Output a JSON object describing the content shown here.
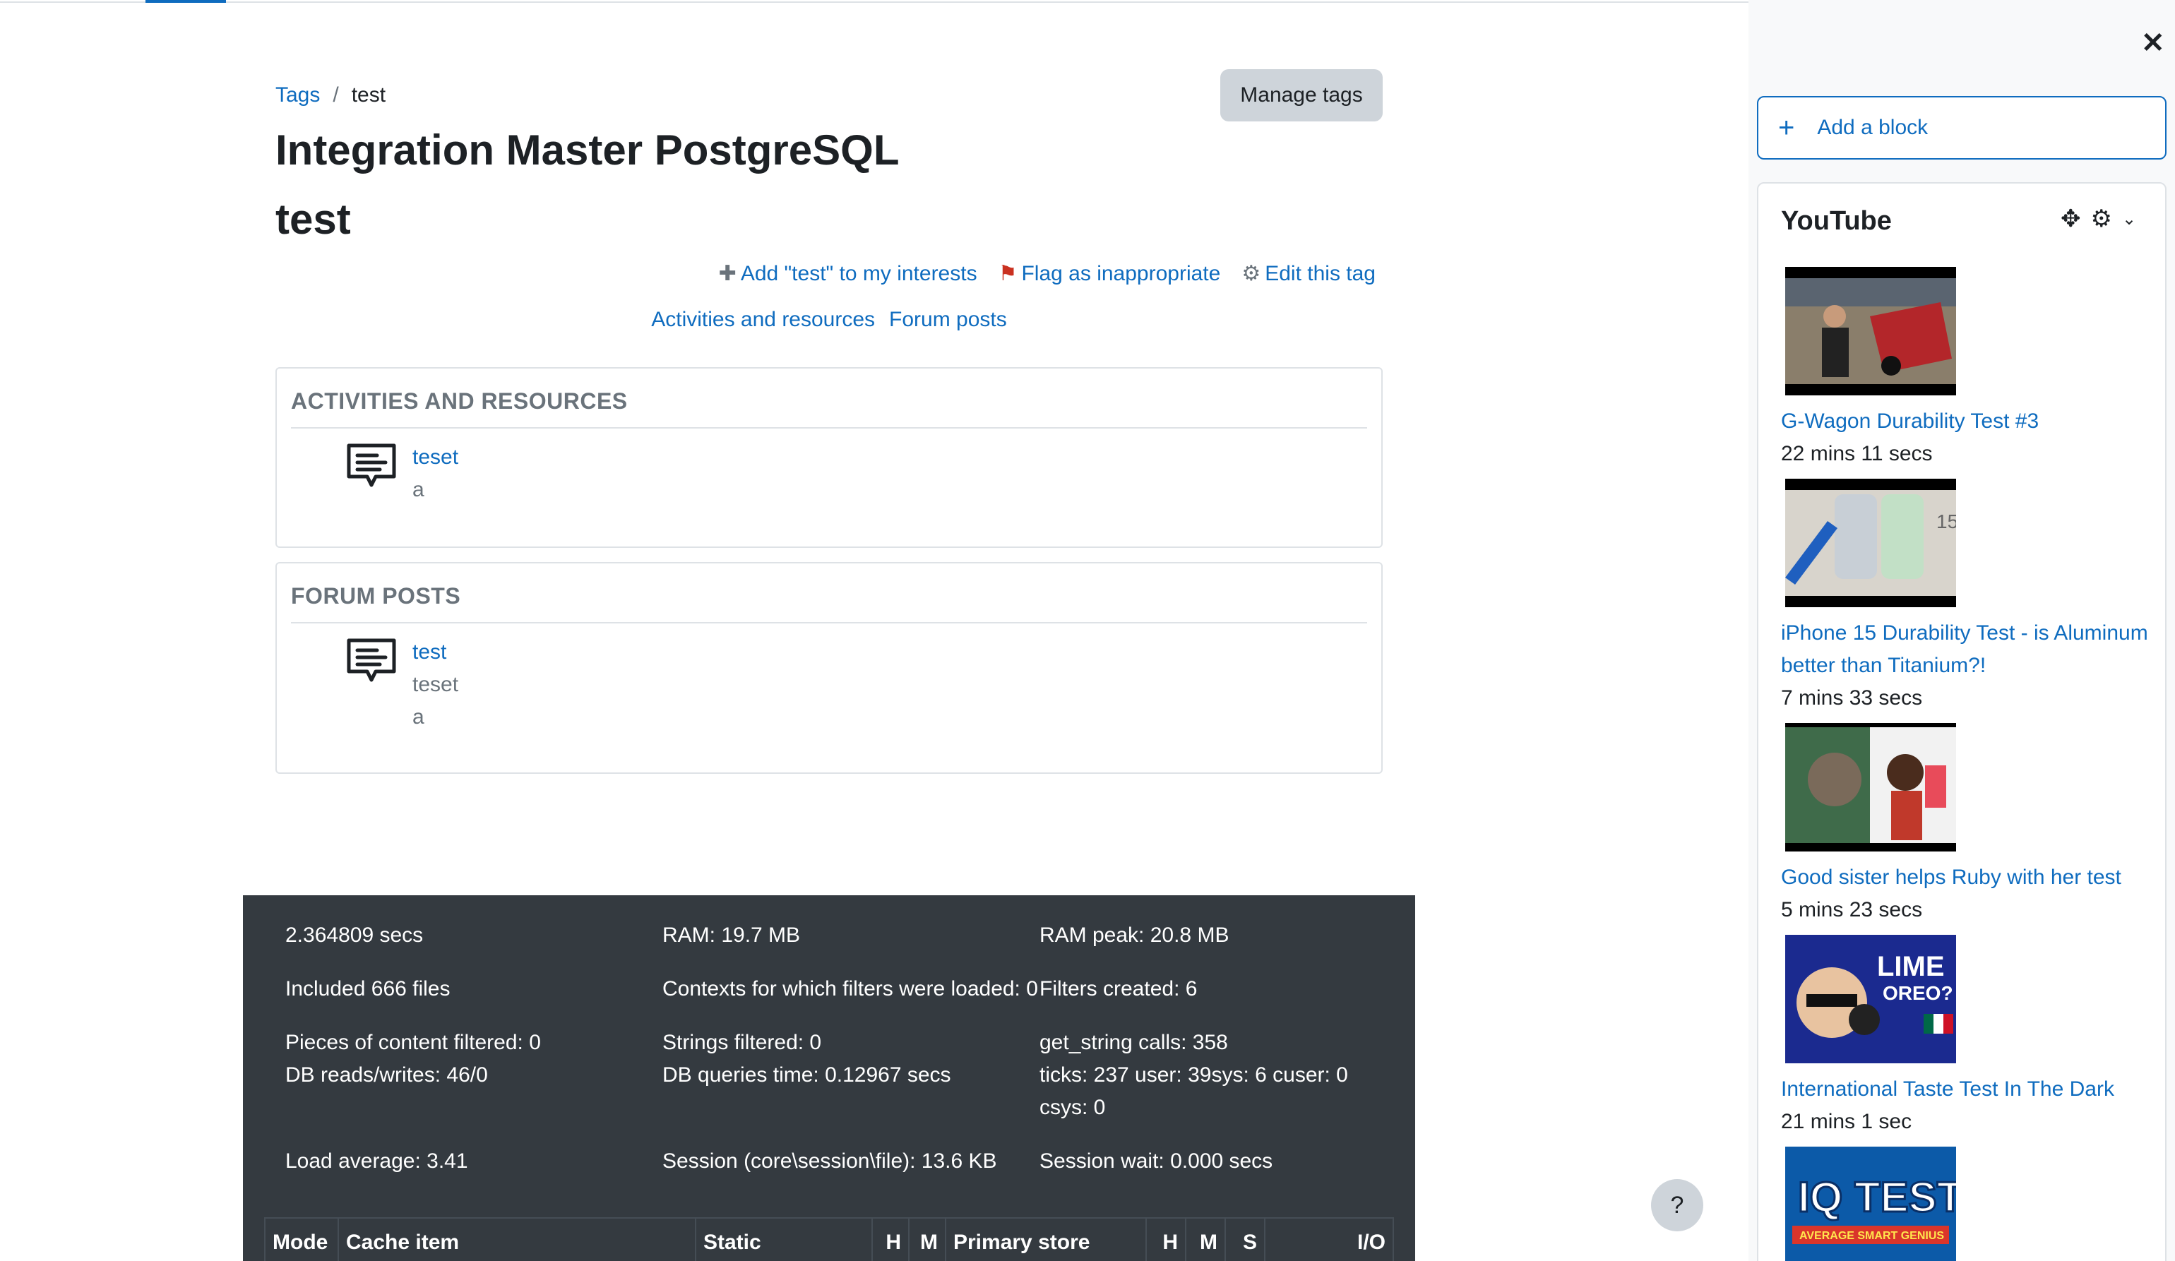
{
  "breadcrumb": {
    "root": "Tags",
    "separator": "/",
    "current": "test"
  },
  "manage_tags_label": "Manage tags",
  "site_title": "Integration Master PostgreSQL",
  "tag_title": "test",
  "tag_actions": {
    "add_interest": "Add \"test\" to my interests",
    "flag": "Flag as inappropriate",
    "edit": "Edit this tag"
  },
  "tag_nav": {
    "activities": "Activities and resources",
    "forum": "Forum posts"
  },
  "activities_box": {
    "heading": "ACTIVITIES AND RESOURCES",
    "items": [
      {
        "title": "teset",
        "sub": "a"
      }
    ]
  },
  "forum_box": {
    "heading": "FORUM POSTS",
    "items": [
      {
        "title": "test",
        "sub1": "teset",
        "sub2": "a"
      }
    ]
  },
  "perf": {
    "time": "2.364809 secs",
    "ram": "RAM: 19.7 MB",
    "ram_peak": "RAM peak: 20.8 MB",
    "included": "Included 666 files",
    "contexts": "Contexts for which filters were loaded: 0",
    "filters": "Filters created: 6",
    "pieces": "Pieces of content filtered: 0",
    "strings": "Strings filtered: 0",
    "get_string": "get_string calls: 358",
    "db_rw": "DB reads/writes: 46/0",
    "db_time": "DB queries time: 0.12967 secs",
    "ticks": "ticks: 237 user: 39sys: 6 cuser: 0 csys: 0",
    "load": "Load average: 3.41",
    "session": "Session (core\\session\\file): 13.6 KB",
    "session_wait": "Session wait: 0.000 secs",
    "table_headers": [
      "Mode",
      "Cache item",
      "Static",
      "H",
      "M",
      "Primary store",
      "H",
      "M",
      "S",
      "I/O"
    ]
  },
  "help_label": "?",
  "drawer": {
    "close": "✕",
    "add_block": "Add a block",
    "youtube": {
      "title": "YouTube",
      "videos": [
        {
          "title": "G-Wagon Durability Test #3",
          "duration": "22 mins 11 secs"
        },
        {
          "title": "iPhone 15 Durability Test - is Aluminum better than Titanium?!",
          "duration": "7 mins 33 secs"
        },
        {
          "title": "Good sister helps Ruby with her test",
          "duration": "5 mins 23 secs"
        },
        {
          "title": "International Taste Test In The Dark",
          "duration": "21 mins 1 sec"
        }
      ],
      "thumb_texts": {
        "lime": "LIME",
        "oreo": "OREO?",
        "iq": "IQ TEST",
        "iq_sub": "AVERAGE SMART GENIUS",
        "badge15": "15"
      }
    }
  },
  "colors": {
    "link": "#0f6cbf",
    "footer_bg": "#343a40",
    "muted": "#6a737b"
  }
}
